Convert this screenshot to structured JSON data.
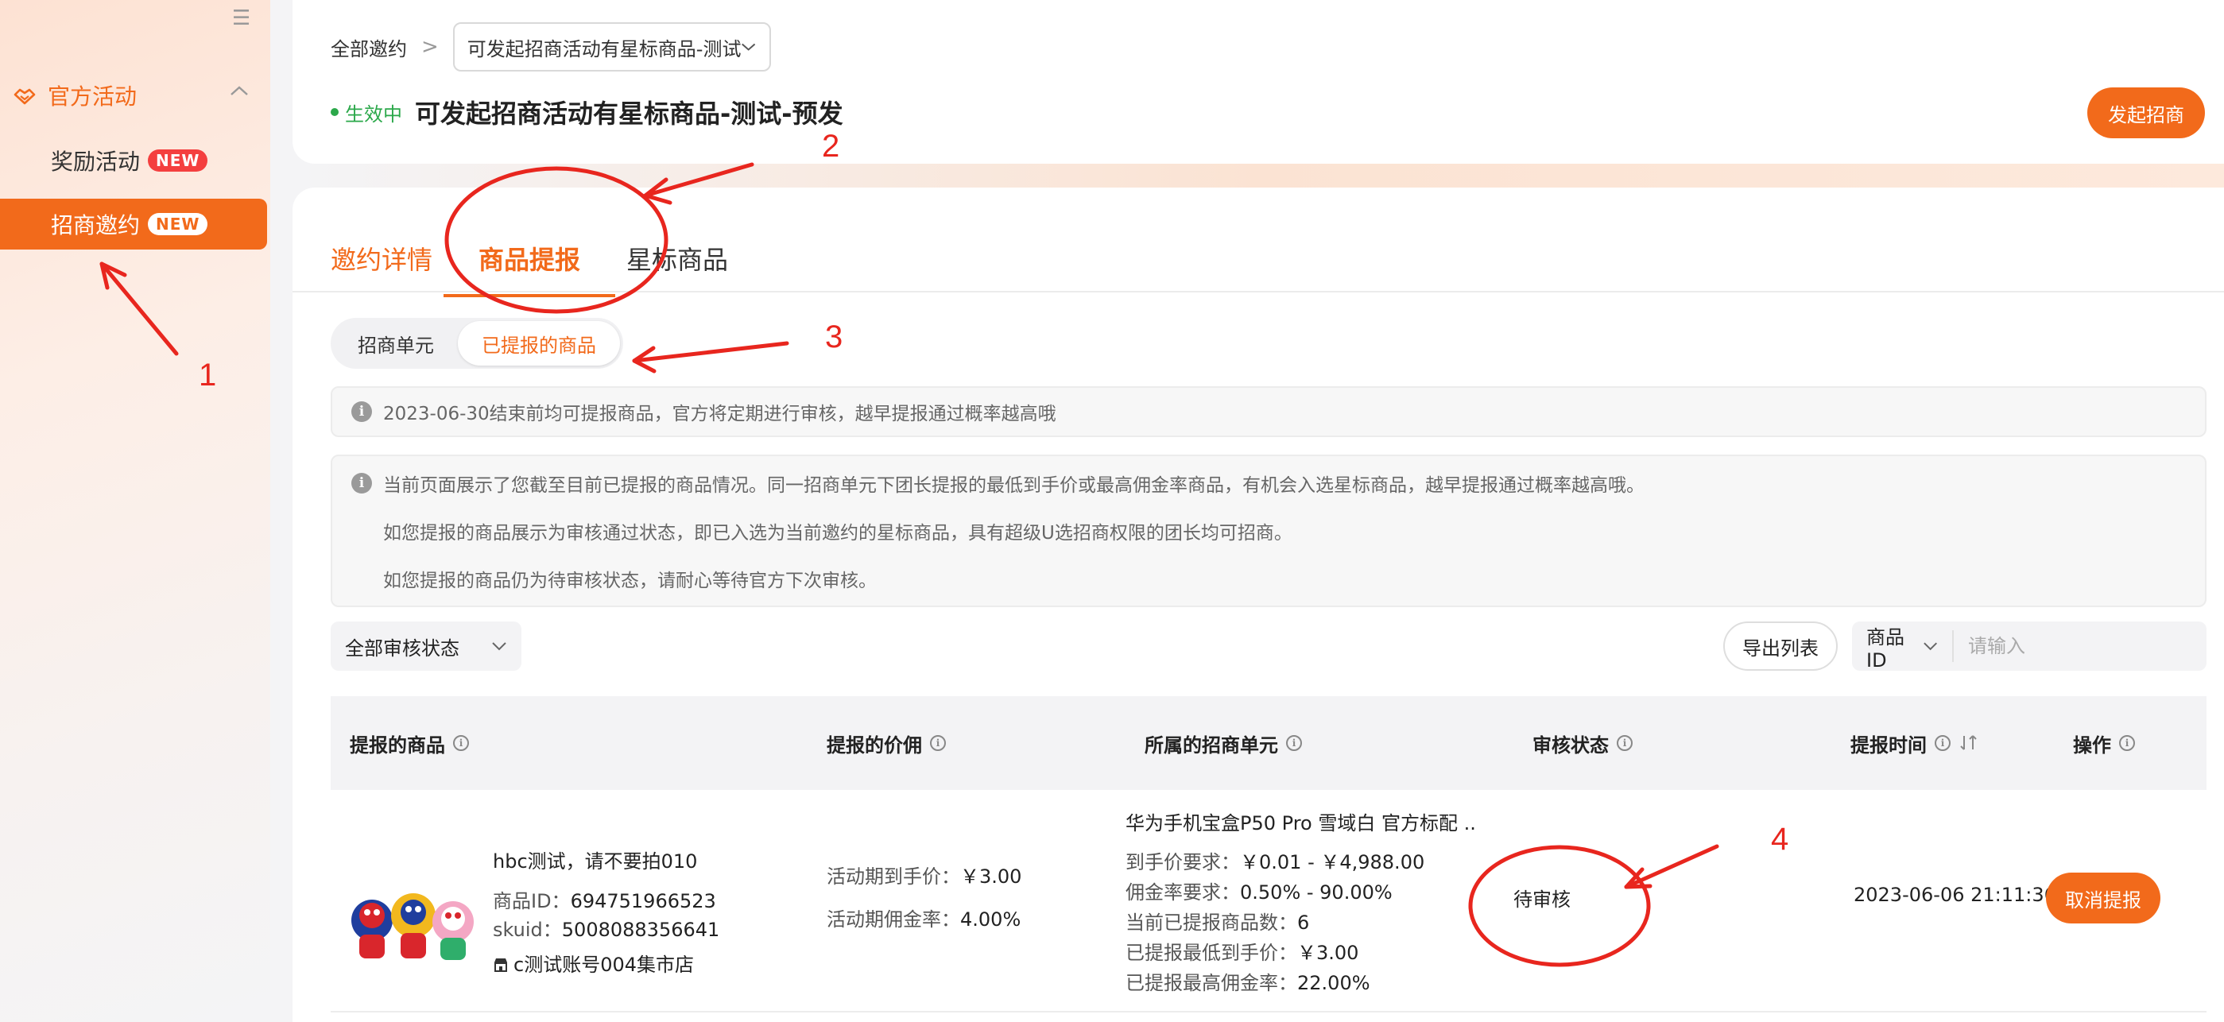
{
  "sidebar": {
    "group_label": "官方活动",
    "items": [
      {
        "label": "奖励活动",
        "badge": "NEW"
      },
      {
        "label": "招商邀约",
        "badge": "NEW"
      }
    ]
  },
  "header": {
    "breadcrumb_root": "全部邀约",
    "breadcrumb_sep": ">",
    "select_value": "可发起招商活动有星标商品-测试",
    "status_text": "生效中",
    "title": "可发起招商活动有星标商品-测试-预发",
    "primary_button": "发起招商"
  },
  "tabs": [
    {
      "label": "邀约详情"
    },
    {
      "label": "商品提报"
    },
    {
      "label": "星标商品"
    }
  ],
  "segments": [
    {
      "label": "招商单元"
    },
    {
      "label": "已提报的商品"
    }
  ],
  "notices": {
    "deadline": "2023-06-30结束前均可提报商品，官方将定期进行审核，越早提报通过概率越高哦",
    "lines": [
      "当前页面展示了您截至目前已提报的商品情况。同一招商单元下团长提报的最低到手价或最高佣金率商品，有机会入选星标商品，越早提报通过概率越高哦。",
      "如您提报的商品展示为审核通过状态，即已入选为当前邀约的星标商品，具有超级U选招商权限的团长均可招商。",
      "如您提报的商品仍为待审核状态，请耐心等待官方下次审核。"
    ]
  },
  "filters": {
    "status_select": "全部审核状态",
    "export_button": "导出列表",
    "search_type": "商品ID",
    "search_placeholder": "请输入"
  },
  "table": {
    "headers": [
      "提报的商品",
      "提报的价佣",
      "所属的招商单元",
      "审核状态",
      "提报时间",
      "操作"
    ],
    "rows": [
      {
        "product_name": "hbc测试，请不要拍010",
        "product_id_label": "商品ID：",
        "product_id": "694751966523",
        "skuid_label": "skuid：",
        "skuid": "5008088356641",
        "shop": "c测试账号004集市店",
        "price_label": "活动期到手价：",
        "price": "￥3.00",
        "commission_label": "活动期佣金率：",
        "commission": "4.00%",
        "unit_title": "华为手机宝盒P50 Pro 雪域白 官方标配 ...",
        "unit_lines": [
          {
            "label": "到手价要求：",
            "value": "￥0.01 - ￥4,988.00"
          },
          {
            "label": "佣金率要求：",
            "value": "0.50% - 90.00%"
          },
          {
            "label": "当前已提报商品数：",
            "value": "6"
          },
          {
            "label": "已提报最低到手价：",
            "value": "￥3.00"
          },
          {
            "label": "已提报最高佣金率：",
            "value": "22.00%"
          }
        ],
        "status": "待审核",
        "time": "2023-06-06 21:11:36",
        "action": "取消提报"
      }
    ]
  },
  "annotations": {
    "numbers": [
      "1",
      "2",
      "3",
      "4"
    ],
    "color": "#e8261e"
  },
  "colors": {
    "accent": "#f26a1b",
    "success": "#2ba84a",
    "badge": "#f43f3f"
  }
}
